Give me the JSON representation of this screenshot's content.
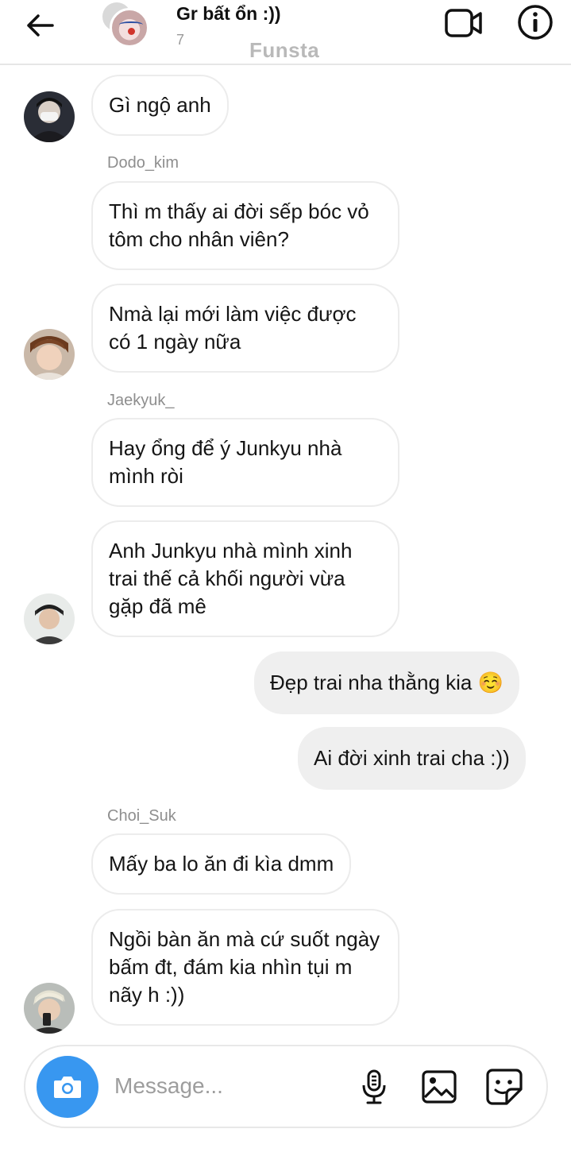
{
  "header": {
    "title": "Gr bất ổn :))",
    "member_count": "7",
    "watermark": "Funsta"
  },
  "messages": {
    "m1": "Gì ngộ anh",
    "sender2": "Dodo_kim",
    "m2": "Thì m thấy ai đời sếp bóc vỏ tôm cho nhân viên?",
    "m3": "Nmà lại mới làm việc được có 1 ngày nữa",
    "sender4": "Jaekyuk_",
    "m4": "Hay ổng để ý Junkyu nhà mình ròi",
    "m5": "Anh Junkyu nhà mình xinh trai thế cả khối người vừa gặp đã mê",
    "m6": "Đẹp trai nha thằng kia ☺️",
    "m7": "Ai đời xinh trai cha :))",
    "sender8": "Choi_Suk",
    "m8": "Mấy ba lo ăn đi kìa dmm",
    "m9": "Ngồi bàn ăn mà cứ suốt ngày bấm đt, đám kia nhìn tụi m nãy h :))"
  },
  "composer": {
    "placeholder": "Message..."
  },
  "icons": {
    "back": "arrow-left-icon",
    "video": "video-camera-icon",
    "info": "info-icon",
    "camera": "camera-icon",
    "mic": "microphone-icon",
    "gallery": "image-icon",
    "sticker": "sticker-icon"
  },
  "colors": {
    "accent": "#3897f0",
    "outgoing_bubble": "#efefef",
    "incoming_border": "#ececec"
  }
}
